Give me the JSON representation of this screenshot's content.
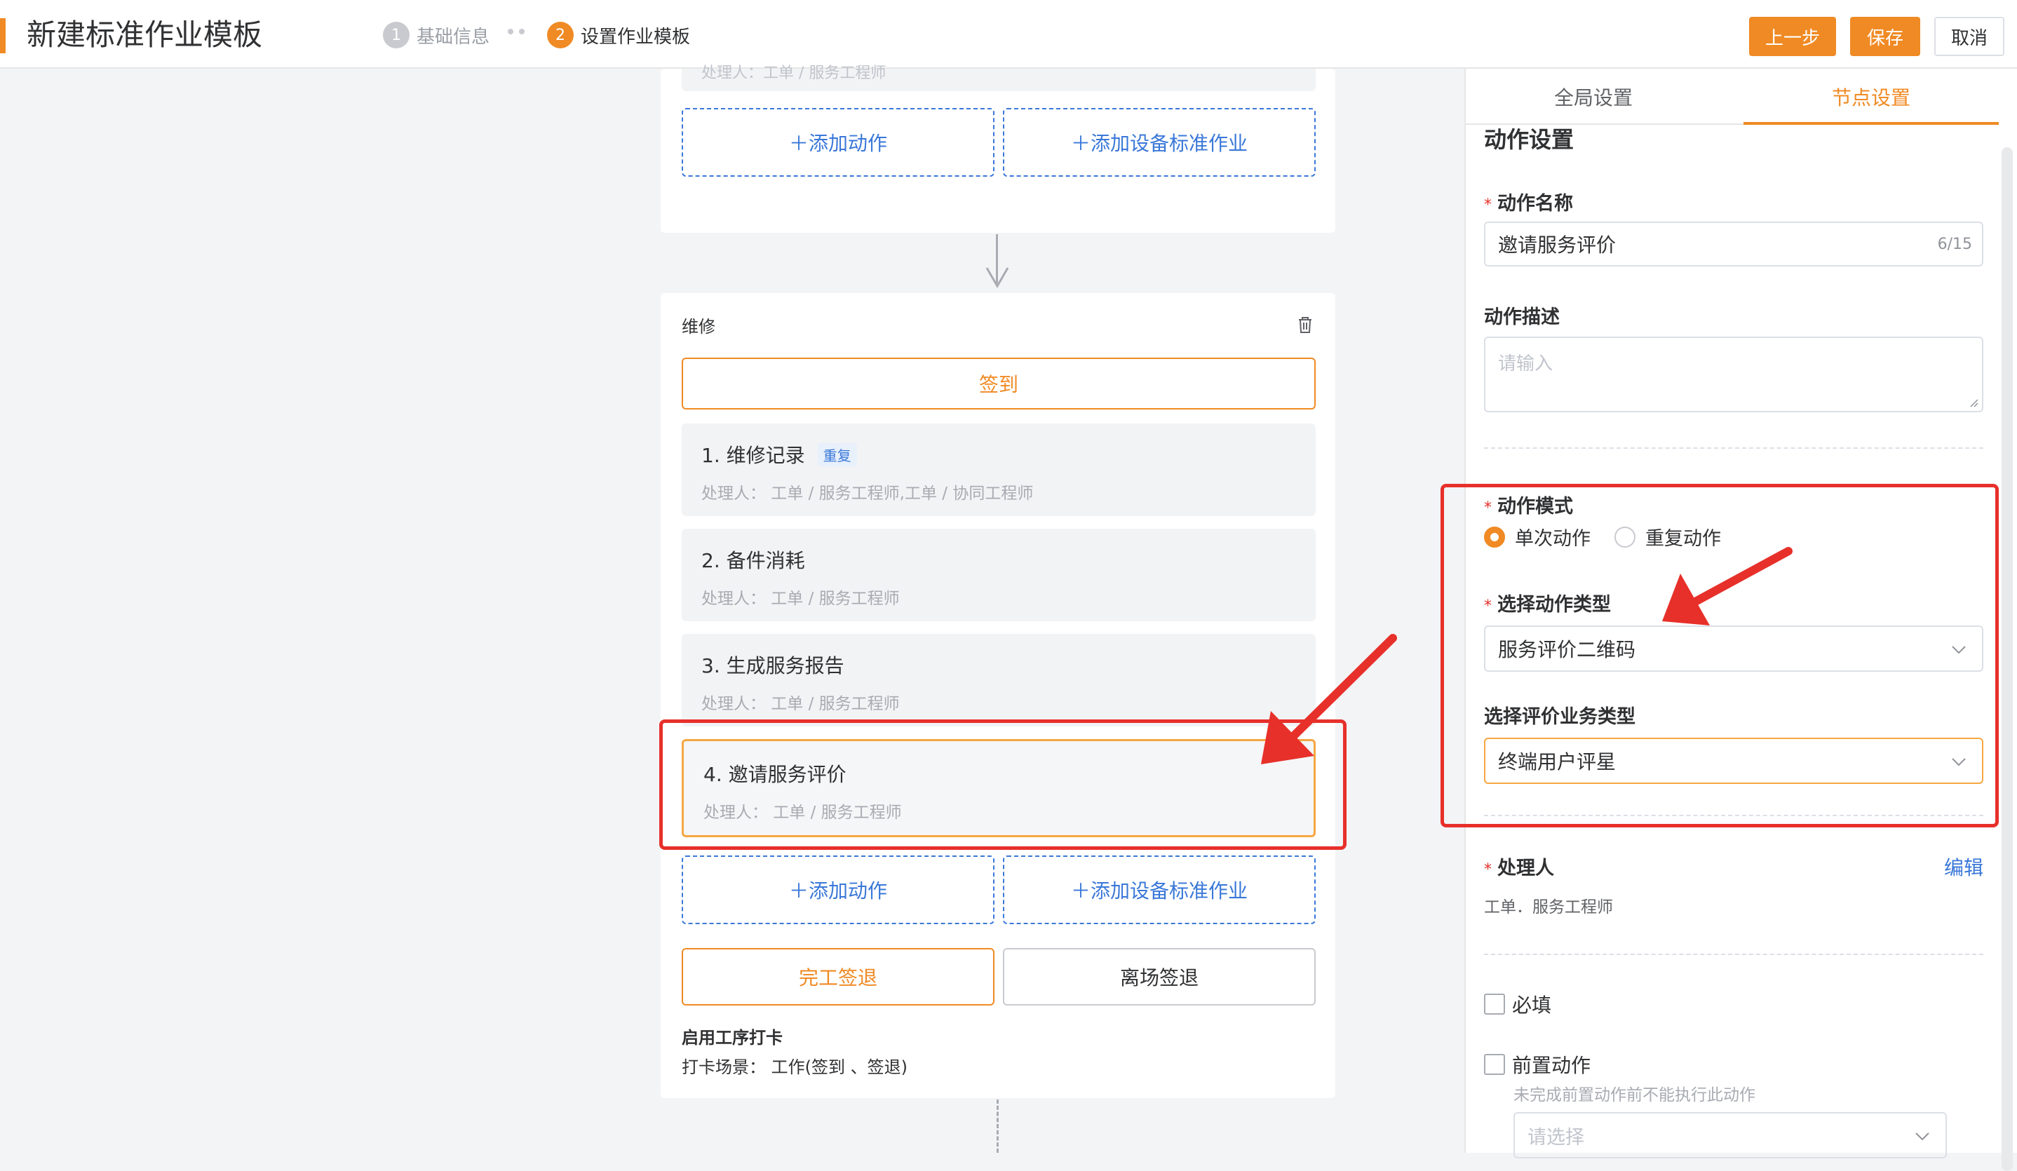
{
  "header": {
    "title": "新建标准作业模板",
    "steps": [
      {
        "num": "1",
        "label": "基础信息"
      },
      {
        "num": "2",
        "label": "设置作业模板"
      }
    ],
    "prev_label": "上一步",
    "save_label": "保存",
    "cancel_label": "取消"
  },
  "canvas": {
    "top_card": {
      "ghost_text": "处理人：工单 / 服务工程师",
      "add_action": "＋添加动作",
      "add_device_job": "＋添加设备标准作业"
    },
    "node": {
      "title": "维修",
      "signin": "签到",
      "actions": [
        {
          "title": "1. 维修记录",
          "tag": "重复",
          "handler": "处理人：  工单 / 服务工程师,工单 / 协同工程师"
        },
        {
          "title": "2. 备件消耗",
          "tag": "",
          "handler": "处理人：  工单 / 服务工程师"
        },
        {
          "title": "3. 生成服务报告",
          "tag": "",
          "handler": "处理人：  工单 / 服务工程师"
        },
        {
          "title": "4. 邀请服务评价",
          "tag": "",
          "handler": "处理人：  工单 / 服务工程师"
        }
      ],
      "add_action": "＋添加动作",
      "add_device_job": "＋添加设备标准作业",
      "finish_checkout": "完工签退",
      "leave_checkout": "离场签退",
      "punch_title": "启用工序打卡",
      "punch_scene": "打卡场景：  工作(签到 、签退)"
    }
  },
  "panel": {
    "tabs": {
      "global": "全局设置",
      "node": "节点设置"
    },
    "section_title": "动作设置",
    "action_name": {
      "label": "动作名称",
      "value": "邀请服务评价",
      "count": "6/15"
    },
    "action_desc": {
      "label": "动作描述",
      "placeholder": "请输入"
    },
    "action_mode": {
      "label": "动作模式",
      "options": [
        "单次动作",
        "重复动作"
      ],
      "selected": "单次动作"
    },
    "action_type": {
      "label": "选择动作类型",
      "value": "服务评价二维码"
    },
    "eval_biz_type": {
      "label": "选择评价业务类型",
      "value": "终端用户评星"
    },
    "handler": {
      "label": "处理人",
      "edit": "编辑",
      "value": "工单．服务工程师"
    },
    "required": {
      "label": "必填"
    },
    "pre_action": {
      "label": "前置动作",
      "hint": "未完成前置动作前不能执行此动作",
      "placeholder": "请选择"
    }
  },
  "colors": {
    "accent": "#f08a24",
    "link": "#3a78d8",
    "annotation": "#e7302a"
  }
}
